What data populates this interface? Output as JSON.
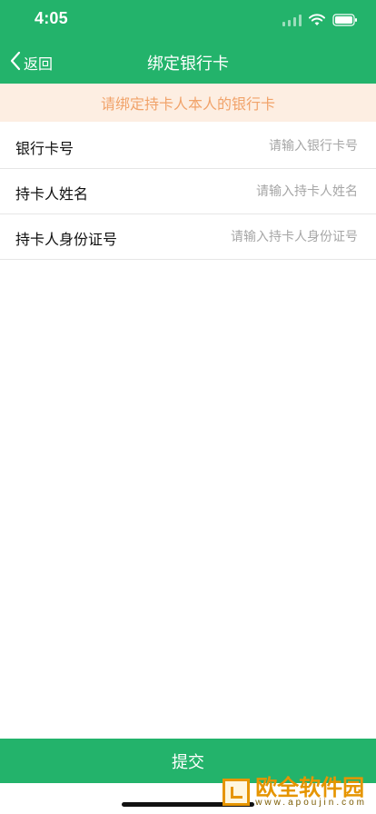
{
  "status_bar": {
    "time": "4:05",
    "icons": [
      "signal-icon",
      "wifi-icon",
      "battery-icon"
    ]
  },
  "nav": {
    "back_label": "返回",
    "title": "绑定银行卡"
  },
  "notice": {
    "text": "请绑定持卡人本人的银行卡"
  },
  "form": {
    "fields": [
      {
        "label": "银行卡号",
        "placeholder": "请输入银行卡号",
        "value": ""
      },
      {
        "label": "持卡人姓名",
        "placeholder": "请输入持卡人姓名",
        "value": ""
      },
      {
        "label": "持卡人身份证号",
        "placeholder": "请输入持卡人身份证号",
        "value": ""
      }
    ]
  },
  "submit": {
    "label": "提交"
  },
  "watermark": {
    "main": "欧全软件园",
    "sub": "www.apoujin.com"
  },
  "colors": {
    "primary": "#23b36b",
    "notice_bg": "#fdeee2",
    "notice_text": "#f1a36a",
    "placeholder": "#a6a6a6"
  }
}
